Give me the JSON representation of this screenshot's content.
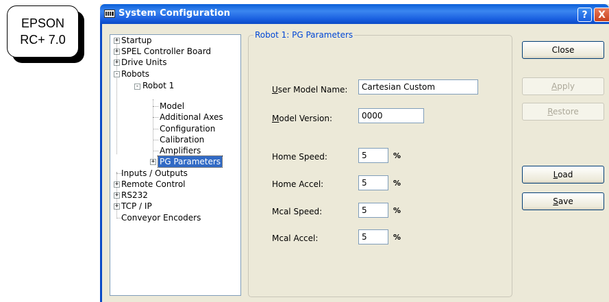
{
  "badge": {
    "line1": "EPSON",
    "line2": "RC+ 7.0"
  },
  "window": {
    "title": "System Configuration",
    "help_label": "?",
    "close_label": "X",
    "close_icon": "close-icon",
    "help_icon": "help-icon"
  },
  "tree": {
    "items": [
      {
        "label": "Startup",
        "expander": "+"
      },
      {
        "label": "SPEL Controller Board",
        "expander": "+"
      },
      {
        "label": "Drive Units",
        "expander": "+"
      },
      {
        "label": "Robots",
        "expander": "-"
      },
      {
        "label": "Robot 1",
        "expander": "-"
      },
      {
        "label": "Model"
      },
      {
        "label": "Additional Axes"
      },
      {
        "label": "Configuration"
      },
      {
        "label": "Calibration"
      },
      {
        "label": "Amplifiers"
      },
      {
        "label": "PG Parameters",
        "expander": "+",
        "selected": true
      },
      {
        "label": "Inputs / Outputs"
      },
      {
        "label": "Remote Control",
        "expander": "+"
      },
      {
        "label": "RS232",
        "expander": "+"
      },
      {
        "label": "TCP / IP",
        "expander": "+"
      },
      {
        "label": "Conveyor Encoders"
      }
    ]
  },
  "panel": {
    "group_title": "Robot 1: PG Parameters",
    "user_model_name": {
      "mnemonic": "U",
      "rest": "ser Model Name:",
      "value": "Cartesian Custom"
    },
    "model_version": {
      "mnemonic": "M",
      "rest": "odel Version:",
      "value": "0000"
    },
    "home_speed": {
      "label": "Home Speed:",
      "value": "5",
      "unit": "%"
    },
    "home_accel": {
      "label": "Home Accel:",
      "value": "5",
      "unit": "%"
    },
    "mcal_speed": {
      "label": "Mcal Speed:",
      "value": "5",
      "unit": "%"
    },
    "mcal_accel": {
      "label": "Mcal Accel:",
      "value": "5",
      "unit": "%"
    }
  },
  "buttons": {
    "close": "Close",
    "apply": {
      "mnemonic": "A",
      "rest": "pply"
    },
    "restore": {
      "mnemonic": "R",
      "rest": "estore"
    },
    "load": {
      "mnemonic": "L",
      "rest": "oad"
    },
    "save": {
      "mnemonic": "S",
      "rest": "ave"
    }
  }
}
